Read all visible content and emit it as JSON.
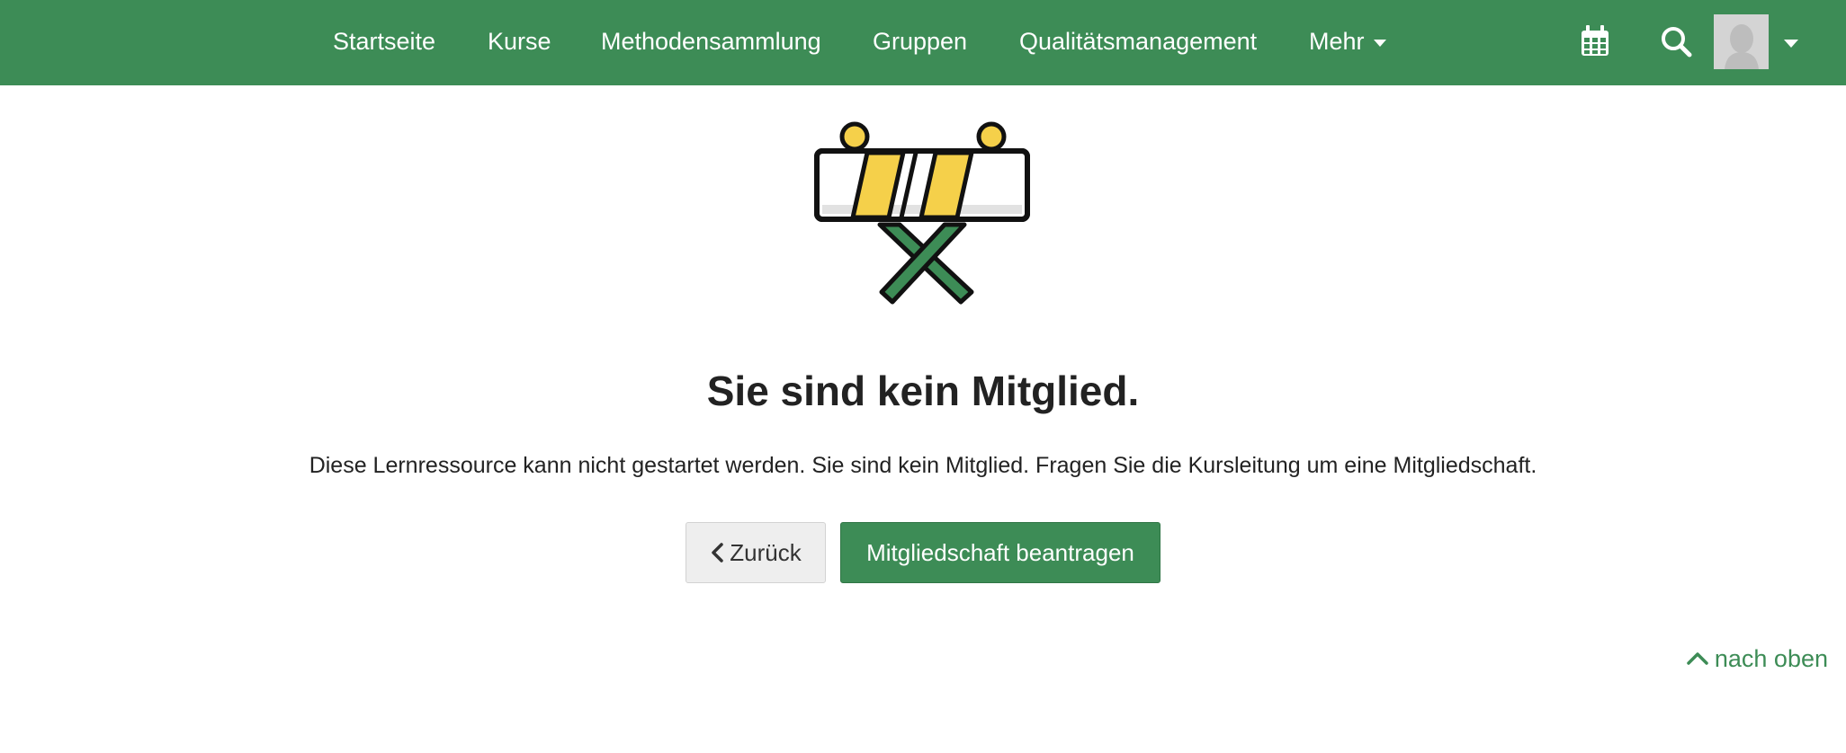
{
  "nav": {
    "items": [
      {
        "label": "Startseite"
      },
      {
        "label": "Kurse"
      },
      {
        "label": "Methodensammlung"
      },
      {
        "label": "Gruppen"
      },
      {
        "label": "Qualitätsmanagement"
      }
    ],
    "more_label": "Mehr"
  },
  "icons": {
    "calendar": "calendar-icon",
    "search": "search-icon",
    "avatar": "user-avatar",
    "caret": "chevron-down-icon",
    "back": "chevron-left-icon",
    "to_top": "chevron-up-icon",
    "illustration": "road-barrier-illustration"
  },
  "colors": {
    "brand_green": "#3d8c56",
    "barrier_yellow": "#f5d04a",
    "button_grey": "#eeeeee"
  },
  "main": {
    "heading": "Sie sind kein Mitglied.",
    "message": "Diese Lernressource kann nicht gestartet werden. Sie sind kein Mitglied. Fragen Sie die Kursleitung um eine Mitgliedschaft.",
    "back_label": "Zurück",
    "request_label": "Mitgliedschaft beantragen"
  },
  "footer": {
    "to_top_label": "nach oben"
  }
}
